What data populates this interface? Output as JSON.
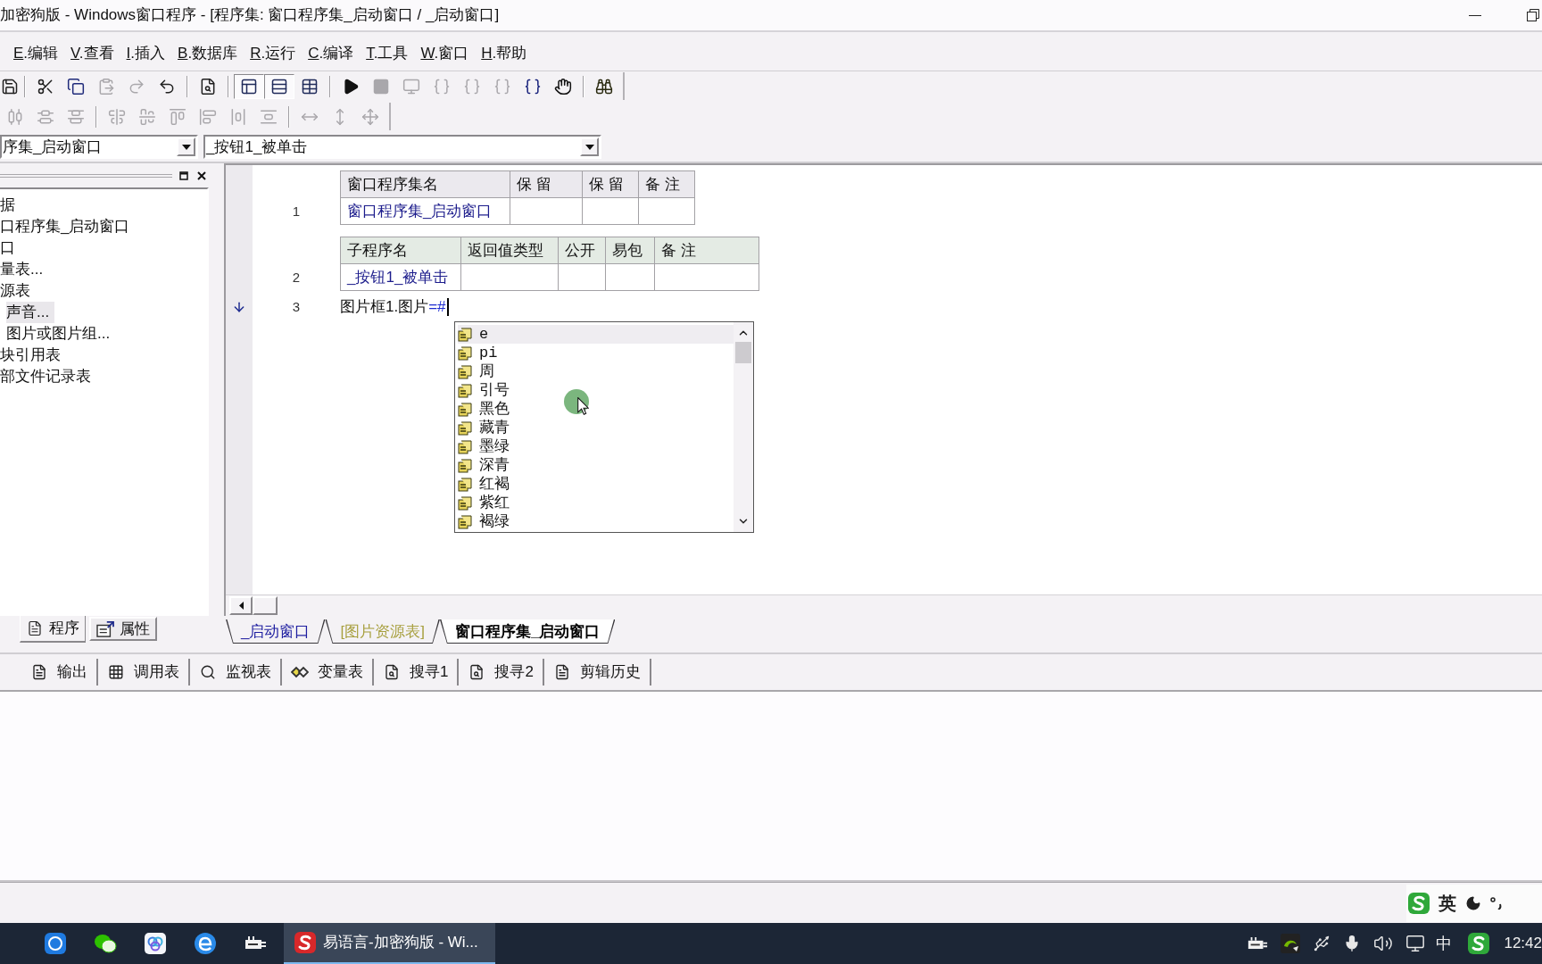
{
  "window": {
    "title": "加密狗版 - Windows窗口程序 - [程序集: 窗口程序集_启动窗口 / _启动窗口]"
  },
  "menu_bar": [
    "E.编辑",
    "V.查看",
    "I.插入",
    "B.数据库",
    "R.运行",
    "C.编译",
    "T.工具",
    "W.窗口",
    "H.帮助"
  ],
  "toolbars": [
    {
      "groups": [
        {
          "buttons": [
            {
              "kind": "save",
              "disabled": false,
              "pressed": false
            }
          ]
        },
        {
          "buttons": [
            {
              "kind": "cut",
              "disabled": false,
              "pressed": false
            },
            {
              "kind": "copy",
              "disabled": false,
              "pressed": false
            },
            {
              "kind": "paste",
              "disabled": true,
              "pressed": false
            },
            {
              "kind": "redo",
              "disabled": true,
              "pressed": false
            },
            {
              "kind": "undo",
              "disabled": false,
              "pressed": false
            }
          ]
        },
        {
          "buttons": [
            {
              "kind": "preview",
              "disabled": false,
              "pressed": false
            }
          ]
        },
        {
          "buttons": [
            {
              "kind": "panes",
              "disabled": false,
              "pressed": true
            },
            {
              "kind": "rows",
              "disabled": false,
              "pressed": true
            },
            {
              "kind": "grid",
              "disabled": false,
              "pressed": false
            }
          ]
        },
        {
          "buttons": [
            {
              "kind": "run",
              "disabled": false,
              "pressed": false
            },
            {
              "kind": "stop",
              "disabled": true,
              "pressed": false
            },
            {
              "kind": "monitor",
              "disabled": true,
              "pressed": false
            },
            {
              "kind": "stepin",
              "disabled": true,
              "pressed": false
            },
            {
              "kind": "stepover",
              "disabled": true,
              "pressed": false
            },
            {
              "kind": "stepout",
              "disabled": true,
              "pressed": false
            },
            {
              "kind": "runto",
              "disabled": false,
              "pressed": false
            },
            {
              "kind": "hand",
              "disabled": false,
              "pressed": false
            }
          ]
        },
        {
          "buttons": [
            {
              "kind": "find",
              "disabled": false,
              "pressed": false
            }
          ]
        }
      ]
    },
    {
      "groups": [
        {
          "buttons": [
            {
              "kind": "spreadh",
              "disabled": true,
              "pressed": false
            },
            {
              "kind": "spreadv",
              "disabled": true,
              "pressed": false
            },
            {
              "kind": "stackv",
              "disabled": true,
              "pressed": false
            }
          ]
        },
        {
          "buttons": [
            {
              "kind": "centerv",
              "disabled": true,
              "pressed": false
            },
            {
              "kind": "centerh",
              "disabled": true,
              "pressed": false
            },
            {
              "kind": "alignt",
              "disabled": true,
              "pressed": false
            },
            {
              "kind": "alignl",
              "disabled": true,
              "pressed": false
            },
            {
              "kind": "spaceh",
              "disabled": true,
              "pressed": false
            },
            {
              "kind": "spacev",
              "disabled": true,
              "pressed": false
            }
          ]
        },
        {
          "buttons": [
            {
              "kind": "widen",
              "disabled": true,
              "pressed": false
            },
            {
              "kind": "heighten",
              "disabled": true,
              "pressed": false
            },
            {
              "kind": "resize",
              "disabled": true,
              "pressed": false
            }
          ]
        }
      ]
    }
  ],
  "selectors": [
    {
      "value": "序集_启动窗口"
    },
    {
      "value": "_按钮1_被单击"
    }
  ],
  "project_panel": {
    "tree": [
      {
        "label": "据",
        "selected": false
      },
      {
        "label": "口程序集_启动窗口",
        "selected": false
      },
      {
        "label": "口",
        "selected": false
      },
      {
        "label": "量表...",
        "selected": false
      },
      {
        "label": "源表",
        "selected": false,
        "children": [
          {
            "label": "声音...",
            "selected": true
          },
          {
            "label": "图片或图片组...",
            "selected": false
          }
        ]
      },
      {
        "label": "块引用表",
        "selected": false
      },
      {
        "label": "部文件记录表",
        "selected": false
      }
    ],
    "tabs": [
      {
        "label": "程序",
        "kind": "program",
        "selected": true
      },
      {
        "label": "属性",
        "kind": "properties",
        "selected": false
      }
    ]
  },
  "editor": {
    "assembly_table": {
      "columns": [
        "窗口程序集名",
        "保 留",
        "保 留",
        "备 注"
      ],
      "rows": [
        {
          "line_number": "1",
          "name": "窗口程序集_启动窗口"
        }
      ]
    },
    "sub_table": {
      "columns": [
        "子程序名",
        "返回值类型",
        "公开",
        "易包",
        "备 注"
      ],
      "rows": [
        {
          "line_number": "2",
          "name": "_按钮1_被单击"
        }
      ]
    },
    "code_lines": [
      {
        "line_number": "3",
        "current": true,
        "parts": [
          {
            "kind": "plain",
            "text": "图片框1.图片"
          },
          {
            "kind": "operator",
            "text": "=#"
          }
        ]
      }
    ],
    "autocomplete": {
      "items": [
        {
          "label": "e",
          "selected": true
        },
        {
          "label": "pi",
          "selected": false
        },
        {
          "label": "周",
          "selected": false
        },
        {
          "label": "引号",
          "selected": false
        },
        {
          "label": "黑色",
          "selected": false
        },
        {
          "label": "藏青",
          "selected": false
        },
        {
          "label": "墨绿",
          "selected": false
        },
        {
          "label": "深青",
          "selected": false
        },
        {
          "label": "红褐",
          "selected": false
        },
        {
          "label": "紫红",
          "selected": false
        },
        {
          "label": "褐绿",
          "selected": false
        }
      ]
    },
    "tabs": [
      {
        "label": "_启动窗口",
        "color": "#1e1ea0",
        "selected": false
      },
      {
        "label": "[图片资源表]",
        "color": "#a8a040",
        "selected": false
      },
      {
        "label": "窗口程序集_启动窗口",
        "color": "#000000",
        "selected": true
      }
    ]
  },
  "output_panel": {
    "tabs": [
      {
        "label": "输出",
        "kind": "output"
      },
      {
        "label": "调用表",
        "kind": "calls"
      },
      {
        "label": "监视表",
        "kind": "watch"
      },
      {
        "label": "变量表",
        "kind": "variables"
      },
      {
        "label": "搜寻1",
        "kind": "search"
      },
      {
        "label": "搜寻2",
        "kind": "search"
      },
      {
        "label": "剪辑历史",
        "kind": "clips"
      }
    ]
  },
  "ime_bar": {
    "mode": "英"
  },
  "taskbar": {
    "active_app": {
      "label": "易语言-加密狗版 - Wi..."
    },
    "input_indicator": "中",
    "clock": "12:42"
  }
}
